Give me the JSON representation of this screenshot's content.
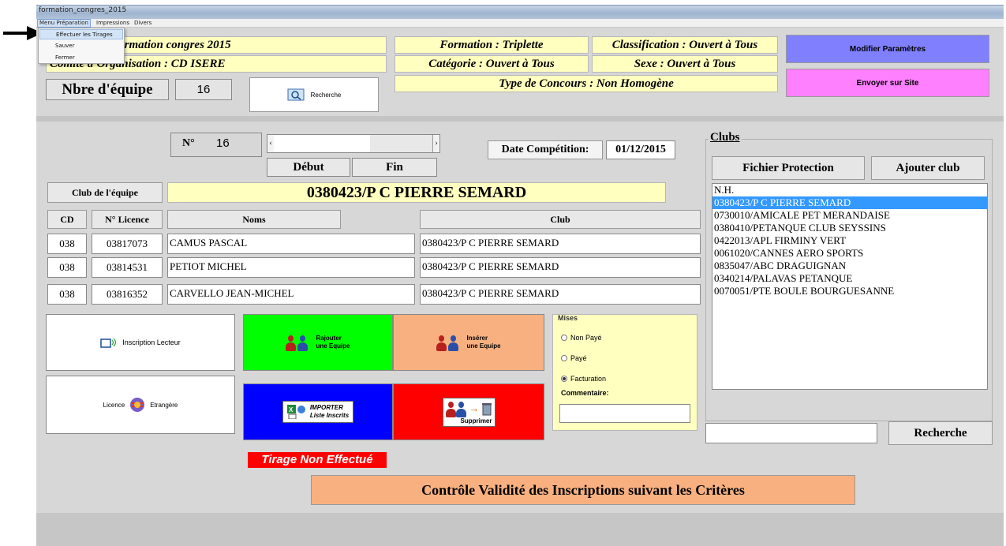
{
  "window": {
    "title": "formation_congres_2015"
  },
  "menubar": {
    "items": [
      "Menu Préparation",
      "Impressions",
      "Divers"
    ]
  },
  "dropdown": {
    "items": [
      "Effectuer les Tirages",
      "Sauver",
      "Fermer"
    ]
  },
  "header": {
    "concours": "rs : formation  congres  2015",
    "comite": "Comite d'Organisation : CD ISERE",
    "formation": "Formation : Triplette",
    "categorie": "Catégorie : Ouvert à Tous",
    "classification": "Classification : Ouvert à Tous",
    "sexe": "Sexe : Ouvert à Tous",
    "type": "Type de Concours : Non Homogène",
    "nbre_label": "Nbre d'équipe",
    "nbre_value": "16",
    "recherche_label": "Recherche",
    "modifier_label": "Modifier Paramètres",
    "envoyer_label": "Envoyer sur Site"
  },
  "team": {
    "no_label": "N°",
    "no_value": "16",
    "debut_label": "Début",
    "fin_label": "Fin",
    "date_label": "Date Compétition:",
    "date_value": "01/12/2015",
    "club_label": "Club de l'équipe",
    "club_value": "0380423/P C PIERRE SEMARD",
    "columns": {
      "cd": "CD",
      "licence": "N° Licence",
      "noms": "Noms",
      "club": "Club"
    },
    "players": [
      {
        "cd": "038",
        "licence": "03817073",
        "nom": "CAMUS PASCAL",
        "club": "0380423/P C PIERRE SEMARD"
      },
      {
        "cd": "038",
        "licence": "03814531",
        "nom": "PETIOT MICHEL",
        "club": "0380423/P C PIERRE SEMARD"
      },
      {
        "cd": "038",
        "licence": "03816352",
        "nom": "CARVELLO JEAN-MICHEL",
        "club": "0380423/P C PIERRE SEMARD"
      }
    ]
  },
  "actions": {
    "inscription_lecteur": "Inscription Lecteur",
    "licence": "Licence",
    "etrangere": "Etrangère",
    "rajouter_1": "Rajouter",
    "rajouter_2": "une Equipe",
    "inserer_1": "Insérer",
    "inserer_2": "une Equipe",
    "importer_1": "IMPORTER",
    "importer_2": "Liste Inscrits",
    "supprimer": "Supprimer"
  },
  "mises": {
    "title": "Mises",
    "options": [
      "Non Payé",
      "Payé",
      "Facturation"
    ],
    "selected": "Facturation",
    "commentaire_label": "Commentaire:"
  },
  "clubs": {
    "title": "Clubs",
    "fichier_protection": "Fichier Protection",
    "ajouter_club": "Ajouter club",
    "items": [
      "N.H.",
      "0380423/P C PIERRE SEMARD",
      "0730010/AMICALE PET MERANDAISE",
      "0380410/PETANQUE CLUB SEYSSINS",
      "0422013/APL FIRMINY VERT",
      "0061020/CANNES AERO SPORTS",
      "0835047/ABC DRAGUIGNAN",
      "0340214/PALAVAS PETANQUE",
      "0070051/PTE BOULE BOURGUESANNE"
    ],
    "selected_index": 1,
    "recherche_label": "Recherche"
  },
  "status": {
    "tirage": "Tirage Non Effectué",
    "controle": "Contrôle Validité des Inscriptions suivant les Critères"
  },
  "colors": {
    "yellow": "#ffffc0",
    "modifier": "#8080ff",
    "envoyer": "#ff80ff",
    "green": "#00ff00",
    "peach": "#f8b080",
    "blue": "#0000ff",
    "red": "#ff0000",
    "selection": "#3399ff"
  }
}
